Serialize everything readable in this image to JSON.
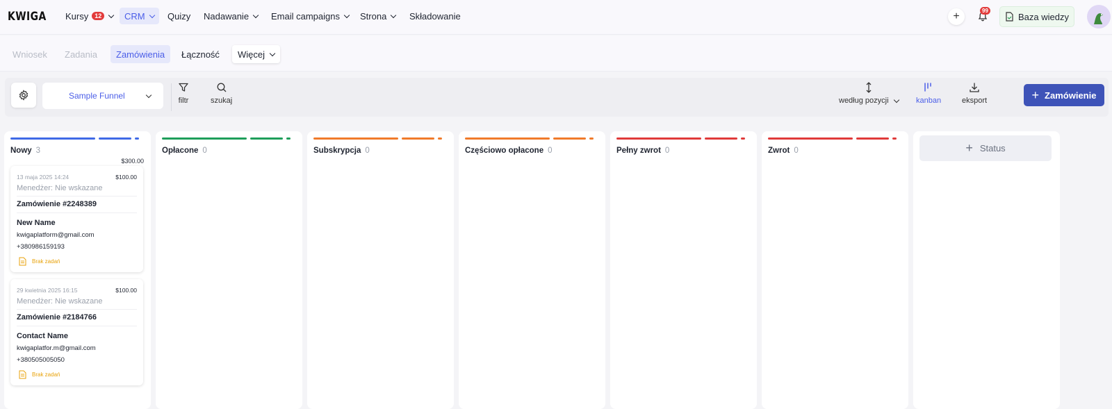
{
  "header": {
    "logo": "KWIGA",
    "nav": [
      {
        "label": "Kursy",
        "badge": "12"
      },
      {
        "label": "CRM"
      },
      {
        "label": "Quizy"
      },
      {
        "label": "Nadawanie"
      },
      {
        "label": "Email campaigns"
      },
      {
        "label": "Strona"
      },
      {
        "label": "Składowanie"
      }
    ],
    "notifications_count": "99",
    "knowledge_base_label": "Baza wiedzy"
  },
  "subnav": {
    "items": [
      {
        "label": "Wniosek"
      },
      {
        "label": "Zadania"
      },
      {
        "label": "Zamówienia"
      },
      {
        "label": "Łączność"
      },
      {
        "label": "Więcej"
      }
    ]
  },
  "toolbar": {
    "funnel": "Sample Funnel",
    "filter_label": "filtr",
    "search_label": "szukaj",
    "sort_label": "według pozycji",
    "kanban_label": "kanban",
    "export_label": "eksport",
    "add_order_label": "Zamówienie"
  },
  "columns": [
    {
      "title": "Nowy",
      "count": "3",
      "total": "$300.00",
      "color": "#3f6ae6"
    },
    {
      "title": "Opłacone",
      "count": "0",
      "color": "#1e9e5a"
    },
    {
      "title": "Subskrypcja",
      "count": "0",
      "color": "#f07a2a"
    },
    {
      "title": "Częściowo opłacone",
      "count": "0",
      "color": "#f07a2a"
    },
    {
      "title": "Pełny zwrot",
      "count": "0",
      "color": "#e03a3a"
    },
    {
      "title": "Zwrot",
      "count": "0",
      "color": "#e03a3a"
    }
  ],
  "add_status_label": "Status",
  "cards": [
    {
      "date": "13 maja 2025 14:24",
      "amount": "$100.00",
      "manager": "Menedżer: Nie wskazane",
      "order": "Zamówienie #2248389",
      "name": "New Name",
      "email": "kwigaplatform@gmail.com",
      "phone": "+380986159193",
      "tasks": "Brak zadań"
    },
    {
      "date": "29 kwietnia 2025 16:15",
      "amount": "$100.00",
      "manager": "Menedżer: Nie wskazane",
      "order": "Zamówienie #2184766",
      "name": "Contact Name",
      "email": "kwigaplatfor.m@gmail.com",
      "phone": "+380505005050",
      "tasks": "Brak zadań"
    }
  ]
}
